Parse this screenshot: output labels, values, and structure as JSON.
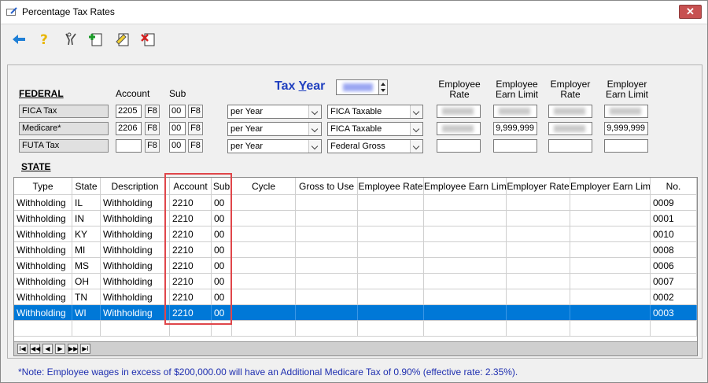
{
  "window": {
    "title": "Percentage Tax Rates",
    "close_glyph": "✕"
  },
  "toolbar": {
    "buttons": [
      {
        "name": "back-arrow-icon"
      },
      {
        "name": "help-icon"
      },
      {
        "name": "tools-icon"
      },
      {
        "name": "add-icon"
      },
      {
        "name": "edit-icon"
      },
      {
        "name": "delete-icon"
      }
    ]
  },
  "federal": {
    "heading": "FEDERAL",
    "col_account": "Account",
    "col_sub": "Sub",
    "tax_year_label_pre": "Tax ",
    "tax_year_label_u": "Y",
    "tax_year_label_post": "ear",
    "hdr_employee_rate": [
      "Employee",
      "Rate"
    ],
    "hdr_employee_earn_limit": [
      "Employee",
      "Earn Limit"
    ],
    "hdr_employer_rate": [
      "Employer",
      "Rate"
    ],
    "hdr_employer_earn_limit": [
      "Employer",
      "Earn Limit"
    ],
    "f8": "F8",
    "rows": [
      {
        "name": "FICA Tax",
        "account": "2205",
        "sub": "00",
        "cycle": "per Year",
        "gross": "FICA Taxable",
        "ee_limit": "",
        "er_limit": ""
      },
      {
        "name": "Medicare*",
        "account": "2206",
        "sub": "00",
        "cycle": "per Year",
        "gross": "FICA Taxable",
        "ee_limit": "9,999,999",
        "er_limit": "9,999,999"
      },
      {
        "name": "FUTA Tax",
        "account": "",
        "sub": "00",
        "cycle": "per Year",
        "gross": "Federal Gross",
        "ee_limit": "",
        "er_limit": ""
      }
    ]
  },
  "state": {
    "heading": "STATE",
    "columns": [
      "Type",
      "State",
      "Description",
      "Account",
      "Sub",
      "Cycle",
      "Gross to Use",
      "Employee Rate",
      "Employee Earn Limit",
      "Employer Rate",
      "Employer Earn Limit",
      "No."
    ],
    "rows": [
      [
        "Withholding",
        "IL",
        "Withholding",
        "2210",
        "00",
        "",
        "",
        "",
        "",
        "",
        "",
        "0009"
      ],
      [
        "Withholding",
        "IN",
        "Withholding",
        "2210",
        "00",
        "",
        "",
        "",
        "",
        "",
        "",
        "0001"
      ],
      [
        "Withholding",
        "KY",
        "Withholding",
        "2210",
        "00",
        "",
        "",
        "",
        "",
        "",
        "",
        "0010"
      ],
      [
        "Withholding",
        "MI",
        "Withholding",
        "2210",
        "00",
        "",
        "",
        "",
        "",
        "",
        "",
        "0008"
      ],
      [
        "Withholding",
        "MS",
        "Withholding",
        "2210",
        "00",
        "",
        "",
        "",
        "",
        "",
        "",
        "0006"
      ],
      [
        "Withholding",
        "OH",
        "Withholding",
        "2210",
        "00",
        "",
        "",
        "",
        "",
        "",
        "",
        "0007"
      ],
      [
        "Withholding",
        "TN",
        "Withholding",
        "2210",
        "00",
        "",
        "",
        "",
        "",
        "",
        "",
        "0002"
      ],
      [
        "Withholding",
        "WI",
        "Withholding",
        "2210",
        "00",
        "",
        "",
        "",
        "",
        "",
        "",
        "0003"
      ]
    ],
    "selected_row": 7,
    "nav_glyphs": [
      "I◀",
      "◀◀",
      "◀",
      "▶",
      "▶▶",
      "▶I"
    ]
  },
  "note": "*Note: Employee wages in excess of $200,000.00 will have an Additional Medicare Tax of 0.90% (effective rate: 2.35%).",
  "colors": {
    "accent_blue": "#0078d7",
    "tax_year_blue": "#1f3fbf",
    "note_blue": "#1f2fb0",
    "highlight_red": "#e0464a"
  }
}
